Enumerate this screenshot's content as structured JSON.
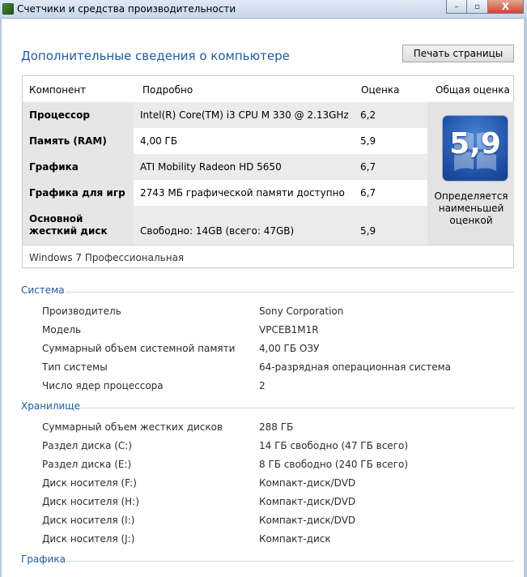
{
  "window": {
    "title": "Счетчики и средства производительности",
    "controls": [
      "–",
      "▫",
      "X"
    ]
  },
  "header": {
    "title": "Дополнительные сведения о компьютере",
    "print_label": "Печать страницы"
  },
  "scores": {
    "columns": [
      "Компонент",
      "Подробно",
      "Оценка",
      "Общая оценка"
    ],
    "rows": [
      {
        "component": "Процессор",
        "detail": "Intel(R) Core(TM) i3 CPU M 330 @ 2.13GHz",
        "score": "6,2"
      },
      {
        "component": "Память (RAM)",
        "detail": "4,00 ГБ",
        "score": "5,9"
      },
      {
        "component": "Графика",
        "detail": "ATI Mobility Radeon HD 5650",
        "score": "6,7"
      },
      {
        "component": "Графика для игр",
        "detail": "2743 МБ графической памяти доступно",
        "score": "6,7"
      },
      {
        "component": "Основной жесткий диск",
        "detail": "Свободно: 14GB (всего: 47GB)",
        "score": "5,9"
      }
    ],
    "overall": "5,9",
    "overall_note": "Определяется наименьшей оценкой",
    "edition": "Windows 7 Профессиональная"
  },
  "system": {
    "title": "Система",
    "items": [
      {
        "label": "Производитель",
        "value": "Sony Corporation"
      },
      {
        "label": "Модель",
        "value": "VPCEB1M1R"
      },
      {
        "label": "Суммарный объем системной памяти",
        "value": "4,00 ГБ ОЗУ"
      },
      {
        "label": "Тип системы",
        "value": "64-разрядная операционная система"
      },
      {
        "label": "Число ядер процессора",
        "value": "2"
      }
    ]
  },
  "storage": {
    "title": "Хранилище",
    "items": [
      {
        "label": "Суммарный объем жестких дисков",
        "value": "288 ГБ"
      },
      {
        "label": "Раздел диска (C:)",
        "value": "14 ГБ свободно (47 ГБ всего)"
      },
      {
        "label": "Раздел диска (E:)",
        "value": "8 ГБ свободно (240 ГБ всего)"
      },
      {
        "label": "Диск носителя (F:)",
        "value": "Компакт-диск/DVD"
      },
      {
        "label": "Диск носителя (H:)",
        "value": "Компакт-диск/DVD"
      },
      {
        "label": "Диск носителя (I:)",
        "value": "Компакт-диск/DVD"
      },
      {
        "label": "Диск носителя (J:)",
        "value": "Компакт-диск"
      }
    ]
  },
  "graphics": {
    "title": "Графика"
  },
  "colors": {
    "accent": "#1e5a9e",
    "panel_gray": "#e6e6e6",
    "badge_blue": "#1f4fa4"
  }
}
